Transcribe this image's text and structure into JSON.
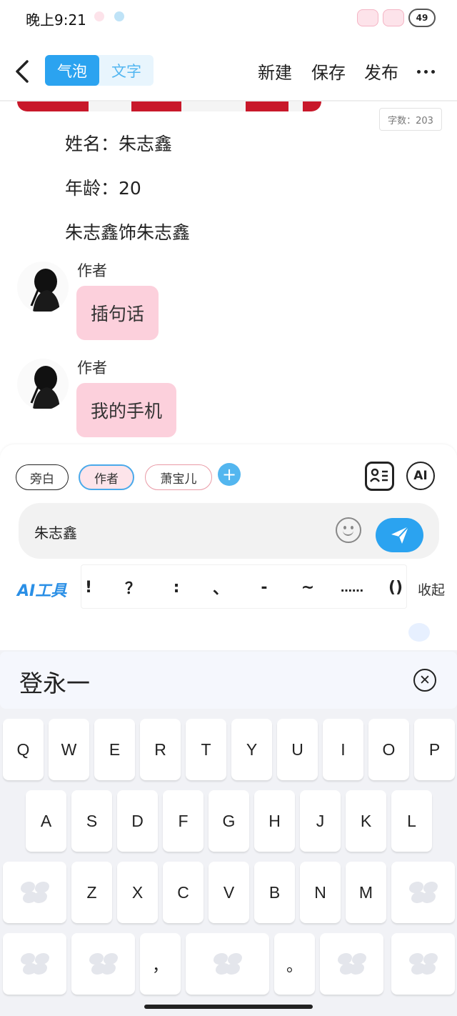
{
  "status_bar": {
    "time": "晚上9:21",
    "battery": "49"
  },
  "header": {
    "back_icon": "chevron-left-icon",
    "segment": {
      "active": "气泡",
      "inactive": "文字"
    },
    "actions": [
      "新建",
      "保存",
      "发布"
    ],
    "more_icon": "more-horizontal-icon"
  },
  "content": {
    "word_count": "字数：203",
    "paragraphs": [
      "姓名：朱志鑫",
      "年龄：20",
      "朱志鑫饰朱志鑫"
    ],
    "messages": [
      {
        "author": "作者",
        "text": "插句话"
      },
      {
        "author": "作者",
        "text": "我的手机"
      }
    ]
  },
  "composer": {
    "chips": {
      "narrator": "旁白",
      "author": "作者",
      "character": "萧宝儿"
    },
    "add_icon": "plus-icon",
    "ai_label": "AI",
    "input_value": "朱志鑫",
    "ai_tools_label": "AI工具",
    "punctuation": [
      "!",
      "？",
      ":",
      "、",
      "-",
      "~",
      "……",
      "()"
    ],
    "collapse_label": "收起"
  },
  "keyboard": {
    "candidate": "登永一",
    "rows": [
      [
        "Q",
        "W",
        "E",
        "R",
        "T",
        "Y",
        "U",
        "I",
        "O",
        "P"
      ],
      [
        "A",
        "S",
        "D",
        "F",
        "G",
        "H",
        "J",
        "K",
        "L"
      ],
      [
        "Z",
        "X",
        "C",
        "V",
        "B",
        "N",
        "M"
      ]
    ],
    "comma": "，",
    "period": "。"
  }
}
